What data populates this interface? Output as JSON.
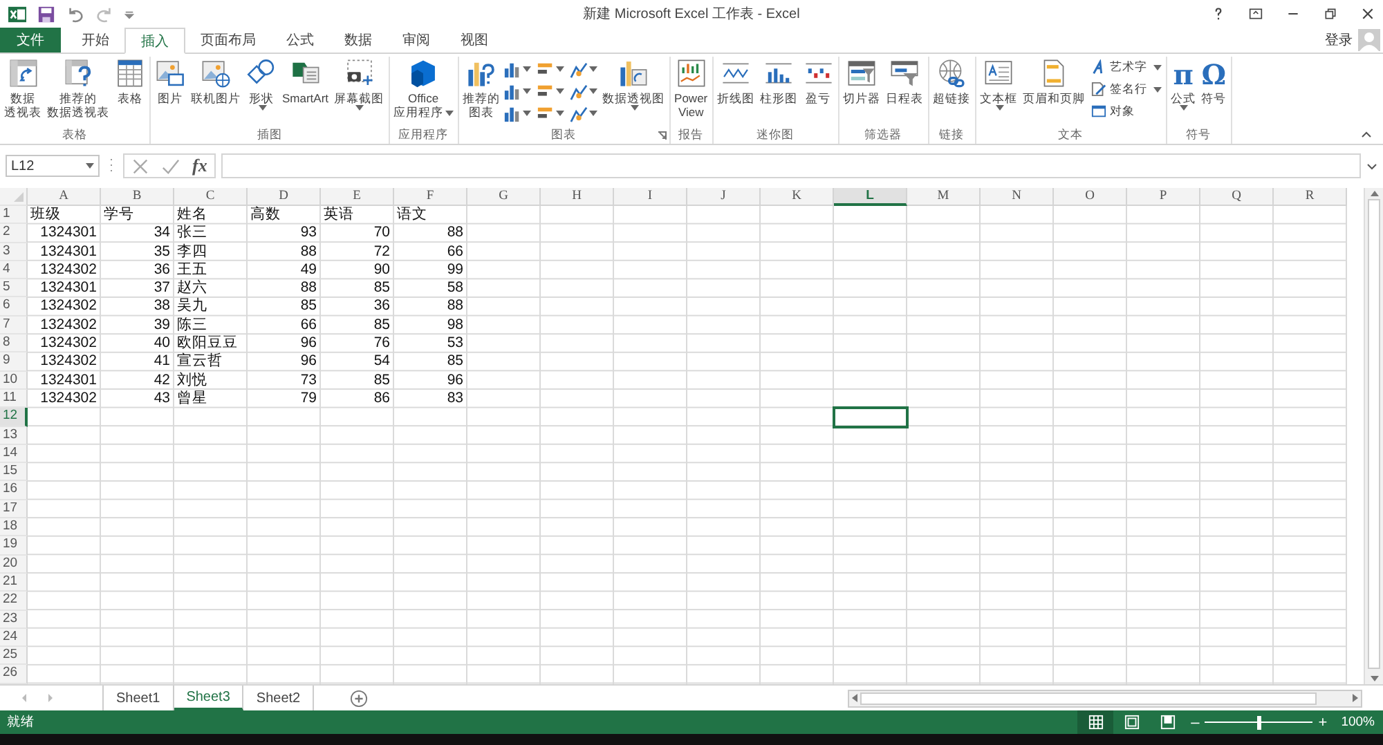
{
  "window": {
    "title": "新建 Microsoft Excel 工作表 - Excel"
  },
  "ribbon_tabs": [
    {
      "label": "文件",
      "kind": "file",
      "selected": false
    },
    {
      "label": "开始",
      "kind": "tab",
      "selected": false
    },
    {
      "label": "插入",
      "kind": "tab",
      "selected": true
    },
    {
      "label": "页面布局",
      "kind": "tab",
      "selected": false
    },
    {
      "label": "公式",
      "kind": "tab",
      "selected": false
    },
    {
      "label": "数据",
      "kind": "tab",
      "selected": false
    },
    {
      "label": "审阅",
      "kind": "tab",
      "selected": false
    },
    {
      "label": "视图",
      "kind": "tab",
      "selected": false
    }
  ],
  "account": {
    "label": "登录"
  },
  "ribbon_groups": [
    {
      "label": "表格",
      "items": [
        {
          "kind": "large",
          "lines": [
            "数据",
            "透视表"
          ]
        },
        {
          "kind": "large",
          "lines": [
            "推荐的",
            "数据透视表"
          ]
        },
        {
          "kind": "large",
          "lines": [
            "表格"
          ]
        }
      ]
    },
    {
      "label": "插图",
      "items": [
        {
          "kind": "large",
          "lines": [
            "图片"
          ]
        },
        {
          "kind": "large",
          "lines": [
            "联机图片"
          ]
        },
        {
          "kind": "large",
          "lines": [
            "形状"
          ],
          "dropdown": true
        },
        {
          "kind": "large",
          "lines": [
            "SmartArt"
          ]
        },
        {
          "kind": "large",
          "lines": [
            "屏幕截图"
          ],
          "dropdown": true
        }
      ]
    },
    {
      "label": "应用程序",
      "items": [
        {
          "kind": "large",
          "lines": [
            "Office",
            "应用程序"
          ],
          "dropdown": true
        }
      ]
    },
    {
      "label": "图表",
      "launcher": true,
      "items": [
        {
          "kind": "large",
          "lines": [
            "推荐的",
            "图表"
          ]
        },
        {
          "kind": "chart-grid"
        },
        {
          "kind": "large",
          "lines": [
            "数据透视图"
          ],
          "dropdown": true
        }
      ]
    },
    {
      "label": "报告",
      "items": [
        {
          "kind": "large",
          "lines": [
            "Power",
            "View"
          ]
        }
      ]
    },
    {
      "label": "迷你图",
      "items": [
        {
          "kind": "large",
          "lines": [
            "折线图"
          ]
        },
        {
          "kind": "large",
          "lines": [
            "柱形图"
          ]
        },
        {
          "kind": "large",
          "lines": [
            "盈亏"
          ]
        }
      ]
    },
    {
      "label": "筛选器",
      "items": [
        {
          "kind": "large",
          "lines": [
            "切片器"
          ]
        },
        {
          "kind": "large",
          "lines": [
            "日程表"
          ]
        }
      ]
    },
    {
      "label": "链接",
      "items": [
        {
          "kind": "large",
          "lines": [
            "超链接"
          ]
        }
      ]
    },
    {
      "label": "文本",
      "items": [
        {
          "kind": "large",
          "lines": [
            "文本框"
          ],
          "dropdown": true
        },
        {
          "kind": "large",
          "lines": [
            "页眉和页脚"
          ]
        },
        {
          "kind": "stack",
          "buttons": [
            {
              "label": "艺术字",
              "dropdown": true
            },
            {
              "label": "签名行",
              "dropdown": true
            },
            {
              "label": "对象"
            }
          ]
        }
      ]
    },
    {
      "label": "符号",
      "items": [
        {
          "kind": "glyph",
          "glyph": "π",
          "lines": [
            "公式"
          ],
          "dropdown": true
        },
        {
          "kind": "glyph",
          "glyph": "Ω",
          "lines": [
            "符号"
          ]
        }
      ]
    }
  ],
  "formula_bar": {
    "name_box": "L12",
    "function_label": "fx"
  },
  "sheet": {
    "columns": [
      {
        "label": "A",
        "selected": false
      },
      {
        "label": "B",
        "selected": false
      },
      {
        "label": "C",
        "selected": false
      },
      {
        "label": "D",
        "selected": false
      },
      {
        "label": "E",
        "selected": false
      },
      {
        "label": "F",
        "selected": false
      },
      {
        "label": "G",
        "selected": false
      },
      {
        "label": "H",
        "selected": false
      },
      {
        "label": "I",
        "selected": false
      },
      {
        "label": "J",
        "selected": false
      },
      {
        "label": "K",
        "selected": false
      },
      {
        "label": "L",
        "selected": true
      },
      {
        "label": "M",
        "selected": false
      },
      {
        "label": "N",
        "selected": false
      },
      {
        "label": "O",
        "selected": false
      },
      {
        "label": "P",
        "selected": false
      },
      {
        "label": "Q",
        "selected": false
      },
      {
        "label": "R",
        "selected": false
      }
    ],
    "rows": [
      {
        "number": "1",
        "selected": false,
        "cells": [
          {
            "text": "班级",
            "kind": "text"
          },
          {
            "text": "学号",
            "kind": "text"
          },
          {
            "text": "姓名",
            "kind": "text"
          },
          {
            "text": "高数",
            "kind": "text"
          },
          {
            "text": "英语",
            "kind": "text"
          },
          {
            "text": "语文",
            "kind": "text"
          }
        ]
      },
      {
        "number": "2",
        "selected": false,
        "cells": [
          {
            "text": "1324301",
            "kind": "number"
          },
          {
            "text": "34",
            "kind": "number"
          },
          {
            "text": "张三",
            "kind": "text"
          },
          {
            "text": "93",
            "kind": "number"
          },
          {
            "text": "70",
            "kind": "number"
          },
          {
            "text": "88",
            "kind": "number"
          }
        ]
      },
      {
        "number": "3",
        "selected": false,
        "cells": [
          {
            "text": "1324301",
            "kind": "number"
          },
          {
            "text": "35",
            "kind": "number"
          },
          {
            "text": "李四",
            "kind": "text"
          },
          {
            "text": "88",
            "kind": "number"
          },
          {
            "text": "72",
            "kind": "number"
          },
          {
            "text": "66",
            "kind": "number"
          }
        ]
      },
      {
        "number": "4",
        "selected": false,
        "cells": [
          {
            "text": "1324302",
            "kind": "number"
          },
          {
            "text": "36",
            "kind": "number"
          },
          {
            "text": "王五",
            "kind": "text"
          },
          {
            "text": "49",
            "kind": "number"
          },
          {
            "text": "90",
            "kind": "number"
          },
          {
            "text": "99",
            "kind": "number"
          }
        ]
      },
      {
        "number": "5",
        "selected": false,
        "cells": [
          {
            "text": "1324301",
            "kind": "number"
          },
          {
            "text": "37",
            "kind": "number"
          },
          {
            "text": "赵六",
            "kind": "text"
          },
          {
            "text": "88",
            "kind": "number"
          },
          {
            "text": "85",
            "kind": "number"
          },
          {
            "text": "58",
            "kind": "number"
          }
        ]
      },
      {
        "number": "6",
        "selected": false,
        "cells": [
          {
            "text": "1324302",
            "kind": "number"
          },
          {
            "text": "38",
            "kind": "number"
          },
          {
            "text": "吴九",
            "kind": "text"
          },
          {
            "text": "85",
            "kind": "number"
          },
          {
            "text": "36",
            "kind": "number"
          },
          {
            "text": "88",
            "kind": "number"
          }
        ]
      },
      {
        "number": "7",
        "selected": false,
        "cells": [
          {
            "text": "1324302",
            "kind": "number"
          },
          {
            "text": "39",
            "kind": "number"
          },
          {
            "text": "陈三",
            "kind": "text"
          },
          {
            "text": "66",
            "kind": "number"
          },
          {
            "text": "85",
            "kind": "number"
          },
          {
            "text": "98",
            "kind": "number"
          }
        ]
      },
      {
        "number": "8",
        "selected": false,
        "cells": [
          {
            "text": "1324302",
            "kind": "number"
          },
          {
            "text": "40",
            "kind": "number"
          },
          {
            "text": "欧阳豆豆",
            "kind": "text"
          },
          {
            "text": "96",
            "kind": "number"
          },
          {
            "text": "76",
            "kind": "number"
          },
          {
            "text": "53",
            "kind": "number"
          }
        ]
      },
      {
        "number": "9",
        "selected": false,
        "cells": [
          {
            "text": "1324302",
            "kind": "number"
          },
          {
            "text": "41",
            "kind": "number"
          },
          {
            "text": "宣云哲",
            "kind": "text"
          },
          {
            "text": "96",
            "kind": "number"
          },
          {
            "text": "54",
            "kind": "number"
          },
          {
            "text": "85",
            "kind": "number"
          }
        ]
      },
      {
        "number": "10",
        "selected": false,
        "cells": [
          {
            "text": "1324301",
            "kind": "number"
          },
          {
            "text": "42",
            "kind": "number"
          },
          {
            "text": "刘悦",
            "kind": "text"
          },
          {
            "text": "73",
            "kind": "number"
          },
          {
            "text": "85",
            "kind": "number"
          },
          {
            "text": "96",
            "kind": "number"
          }
        ]
      },
      {
        "number": "11",
        "selected": false,
        "cells": [
          {
            "text": "1324302",
            "kind": "number"
          },
          {
            "text": "43",
            "kind": "number"
          },
          {
            "text": "曾星",
            "kind": "text"
          },
          {
            "text": "79",
            "kind": "number"
          },
          {
            "text": "86",
            "kind": "number"
          },
          {
            "text": "83",
            "kind": "number"
          }
        ]
      },
      {
        "number": "12",
        "selected": true,
        "cells": []
      },
      {
        "number": "13",
        "selected": false,
        "cells": []
      },
      {
        "number": "14",
        "selected": false,
        "cells": []
      },
      {
        "number": "15",
        "selected": false,
        "cells": []
      },
      {
        "number": "16",
        "selected": false,
        "cells": []
      },
      {
        "number": "17",
        "selected": false,
        "cells": []
      },
      {
        "number": "18",
        "selected": false,
        "cells": []
      },
      {
        "number": "19",
        "selected": false,
        "cells": []
      },
      {
        "number": "20",
        "selected": false,
        "cells": []
      },
      {
        "number": "21",
        "selected": false,
        "cells": []
      },
      {
        "number": "22",
        "selected": false,
        "cells": []
      },
      {
        "number": "23",
        "selected": false,
        "cells": []
      },
      {
        "number": "24",
        "selected": false,
        "cells": []
      },
      {
        "number": "25",
        "selected": false,
        "cells": []
      },
      {
        "number": "26",
        "selected": false,
        "cells": []
      }
    ]
  },
  "sheet_tabs": [
    {
      "label": "Sheet1",
      "selected": false
    },
    {
      "label": "Sheet3",
      "selected": true
    },
    {
      "label": "Sheet2",
      "selected": false
    }
  ],
  "status_bar": {
    "status": "就绪",
    "views": [
      {
        "kind": "normal",
        "selected": true
      },
      {
        "kind": "page-layout",
        "selected": false
      },
      {
        "kind": "page-break",
        "selected": false
      }
    ],
    "zoom": {
      "out": "–",
      "level": 0.5,
      "in": "+",
      "reading": "100%"
    }
  }
}
